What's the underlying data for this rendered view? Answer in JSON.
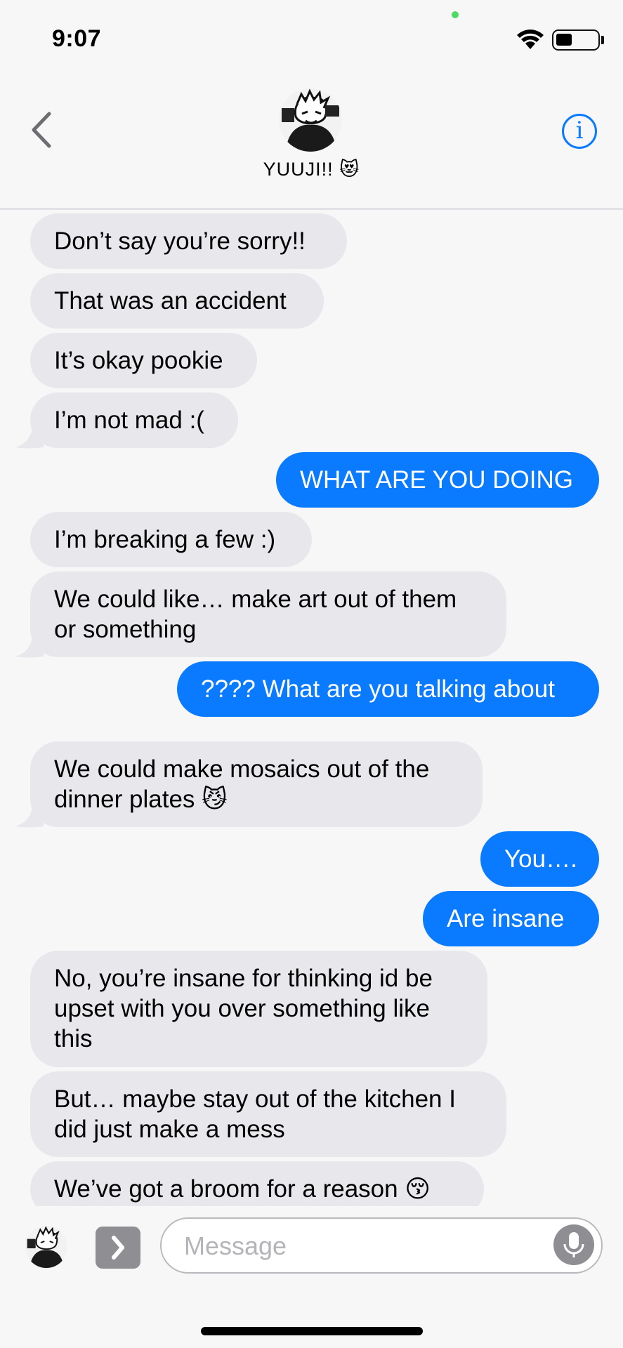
{
  "status": {
    "time": "9:07"
  },
  "header": {
    "contact_name": "YUUJI!! 😻",
    "info_label": "i"
  },
  "messages": [
    {
      "from": "them",
      "text": "Don’t say you’re sorry!!"
    },
    {
      "from": "them",
      "text": "That was an accident"
    },
    {
      "from": "them",
      "text": "It’s okay pookie"
    },
    {
      "from": "them",
      "text": "I’m not mad :("
    },
    {
      "from": "me",
      "text": "WHAT ARE YOU DOING"
    },
    {
      "from": "them",
      "text": "I’m breaking a few :)"
    },
    {
      "from": "them",
      "line1": "We could like… make art out of them",
      "line2": "or something"
    },
    {
      "from": "me",
      "text": "???? What are you talking about"
    },
    {
      "from": "them",
      "line1": "We could make mosaics out of the",
      "line2": "dinner plates 😼"
    },
    {
      "from": "me",
      "text": "You…."
    },
    {
      "from": "me",
      "text": "Are insane"
    },
    {
      "from": "them",
      "line1": "No, you’re insane for thinking id be",
      "line2": "upset with you over something like",
      "line3": "this"
    },
    {
      "from": "them",
      "line1": "But… maybe stay out of the kitchen I",
      "line2": "did just make a mess"
    },
    {
      "from": "them",
      "text": "We’ve got a broom for a reason 😚"
    }
  ],
  "composer": {
    "placeholder": "Message"
  },
  "colors": {
    "accent": "#0a7aff",
    "incoming_bubble": "#e8e7ec",
    "background": "#f7f7f8"
  }
}
